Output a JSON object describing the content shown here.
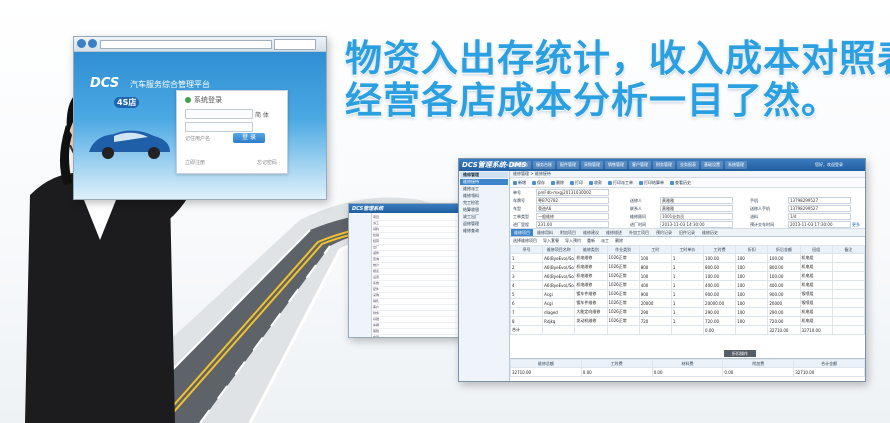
{
  "headline": {
    "line1": "物资入出存统计，收入成本对照表",
    "line2": "经营各店成本分析一目了然。"
  },
  "login": {
    "logo": "DCS",
    "platform": "汽车服务综合管理平台",
    "badge": "4S店",
    "panel_title": "系统登录",
    "lang": "简 体",
    "login_button": "登 录",
    "remember": "记住用户名",
    "footer_left": "立即注册",
    "footer_right": "忘记密码"
  },
  "dms": {
    "logo": "DCS管理系统-DMS",
    "nav": [
      "维修业务",
      "服务台账",
      "配件管理",
      "采购管理",
      "销售管理",
      "客户管理",
      "财务管理",
      "业务报表",
      "基础设置",
      "系统管理"
    ],
    "user": "您好，欢迎登录",
    "sidebar": [
      {
        "label": "维修管理",
        "type": "h"
      },
      {
        "label": "维修接待",
        "type": "sel"
      },
      {
        "label": "维修派工",
        "type": ""
      },
      {
        "label": "维修领料",
        "type": ""
      },
      {
        "label": "完工检验",
        "type": ""
      },
      {
        "label": "结算收银",
        "type": ""
      },
      {
        "label": "竣工出厂",
        "type": ""
      },
      {
        "label": "返修管理",
        "type": ""
      },
      {
        "label": "维修查询",
        "type": ""
      }
    ],
    "breadcrumb": "维修管理 > 维修接待",
    "toolbar": [
      "新增",
      "保存",
      "删除",
      "打印",
      "收款",
      "打印派工单",
      "打印结算单",
      "查看历史"
    ],
    "form": {
      "order_label": "单号",
      "order_value": "pmFdb-mxgj20131030002",
      "vehicle_label": "车牌号",
      "vehicle_value": "粤B7Q782",
      "brand_label": "车型",
      "brand_value": "奥迪A6",
      "type_label": "工单类型",
      "type_value": "一般维修",
      "mileage_label": "进厂里程",
      "mileage_value": "231.00",
      "cust_label": "送修人",
      "cust_value": "黄雅雅",
      "contact_label": "联系人",
      "contact_value": "黄雅雅",
      "service_label": "维修顾问",
      "service_value": "1001业务员",
      "in_time_label": "进厂时间",
      "in_time_value": "2013-11-03 14:30:00",
      "phone_label": "手机",
      "phone_value": "13798299527",
      "phone2_label": "送修人手机",
      "phone2_value": "13798299527",
      "fuel_label": "油料",
      "fuel_value": "1/4",
      "out_time_label": "预计交车时间",
      "out_time_value": "2013-11-03 17:30:00",
      "more": "更多"
    },
    "tabs": [
      "维修项目",
      "维修用料",
      "附加项目",
      "维修建议",
      "维修描述",
      "外加工项目",
      "预约记录",
      "旧件记录",
      "维修历史"
    ],
    "actions": [
      "选择维修项目",
      "导入套餐",
      "导入预约",
      "重新",
      "派工",
      "删除"
    ],
    "grid_headers": [
      "序号",
      "维修项目名称",
      "维修类别",
      "作业类别",
      "工时",
      "工时单价",
      "工时费",
      "折扣",
      "折后金额",
      "班组",
      "备注"
    ],
    "grid_rows": [
      [
        "1",
        "A6(ByeEvo)/Sogki A190",
        "机电维修",
        "1026正常",
        "100",
        "1",
        "100.00",
        "100",
        "100.00",
        "机电组",
        ""
      ],
      [
        "2",
        "A6(ByeEvo)/Sogki A190",
        "机电维修",
        "1026正常",
        "800",
        "1",
        "800.00",
        "100",
        "800.00",
        "机电组",
        ""
      ],
      [
        "3",
        "A6(ByeEvo)/Sogki A190",
        "机电维修",
        "1026正常",
        "100",
        "1",
        "100.00",
        "100",
        "100.00",
        "机电组",
        ""
      ],
      [
        "4",
        "A6(ByeEvo)/Sogki A190",
        "机电维修",
        "1026正常",
        "400",
        "1",
        "400.00",
        "100",
        "400.00",
        "机电组",
        ""
      ],
      [
        "5",
        "Acgi",
        "镀车件维修",
        "1026正常",
        "900",
        "1",
        "900.00",
        "100",
        "900.00",
        "钣喷组",
        ""
      ],
      [
        "6",
        "Acgi",
        "镀车件维修",
        "1026正常",
        "20000",
        "1",
        "20000.00",
        "100",
        "20000",
        "钣喷组",
        ""
      ],
      [
        "7",
        "diaged",
        "大能定向维修",
        "1026正常",
        "290",
        "1",
        "290.00",
        "100",
        "290.00",
        "机电组",
        ""
      ],
      [
        "8",
        "Rdjkq",
        "发动机维修",
        "1026正常",
        "720",
        "1",
        "720.00",
        "100",
        "720.00",
        "机电组",
        ""
      ]
    ],
    "total_label": "合计",
    "total_a": "0.00",
    "total_b": "32710.00",
    "total_c": "32710.00",
    "foot_button": "折扣操作",
    "foot_labels": [
      "维修总额",
      "工时费",
      "材料费",
      "附加费",
      "合计金额"
    ],
    "foot_values": [
      "32710.00",
      "0.00",
      "0.00",
      "0.00",
      "32710.00"
    ]
  },
  "mid_window": {
    "logo": "DCS管理系统",
    "rows": [
      "项目",
      "派工",
      "领料",
      "检验",
      "结算",
      "出厂",
      "返修",
      "查询",
      "统计",
      "报表",
      "设置",
      "系统",
      "配件",
      "采购",
      "销售",
      "客户",
      "财务",
      "基础",
      "车辆",
      "保险",
      "会员",
      "短信",
      "预警",
      "台账",
      "历史"
    ]
  }
}
